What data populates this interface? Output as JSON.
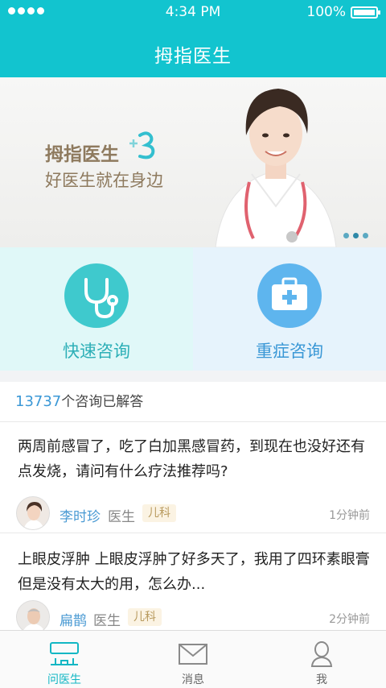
{
  "status_bar": {
    "time": "4:34 PM",
    "battery": "100%"
  },
  "header": {
    "title": "拇指医生"
  },
  "banner": {
    "brand": "拇指医生",
    "slogan": "好医生就在身边"
  },
  "actions": [
    {
      "label": "快速咨询",
      "icon": "stethoscope-icon"
    },
    {
      "label": "重症咨询",
      "icon": "medical-kit-icon"
    }
  ],
  "consult": {
    "count": "13737",
    "count_suffix": "个咨询已解答",
    "items": [
      {
        "question": "两周前感冒了，吃了白加黑感冒药，到现在也没好还有点发烧，请问有什么疗法推荐吗?",
        "doctor": "李时珍",
        "title": "医生",
        "dept": "儿科",
        "time": "1分钟前"
      },
      {
        "question": "上眼皮浮肿 上眼皮浮肿了好多天了，我用了四环素眼膏但是没有太大的用，怎么办...",
        "doctor": "扁鹊",
        "title": "医生",
        "dept": "儿科",
        "time": "2分钟前"
      }
    ]
  },
  "tabbar": [
    {
      "label": "问医生",
      "icon": "ask-doctor-icon",
      "active": true
    },
    {
      "label": "消息",
      "icon": "envelope-icon",
      "active": false
    },
    {
      "label": "我",
      "icon": "person-icon",
      "active": false
    }
  ],
  "colors": {
    "brand": "#12c4cf",
    "quick": "#3fc9cd",
    "serious": "#5eb5ee",
    "accent_blue": "#3b98d6"
  }
}
